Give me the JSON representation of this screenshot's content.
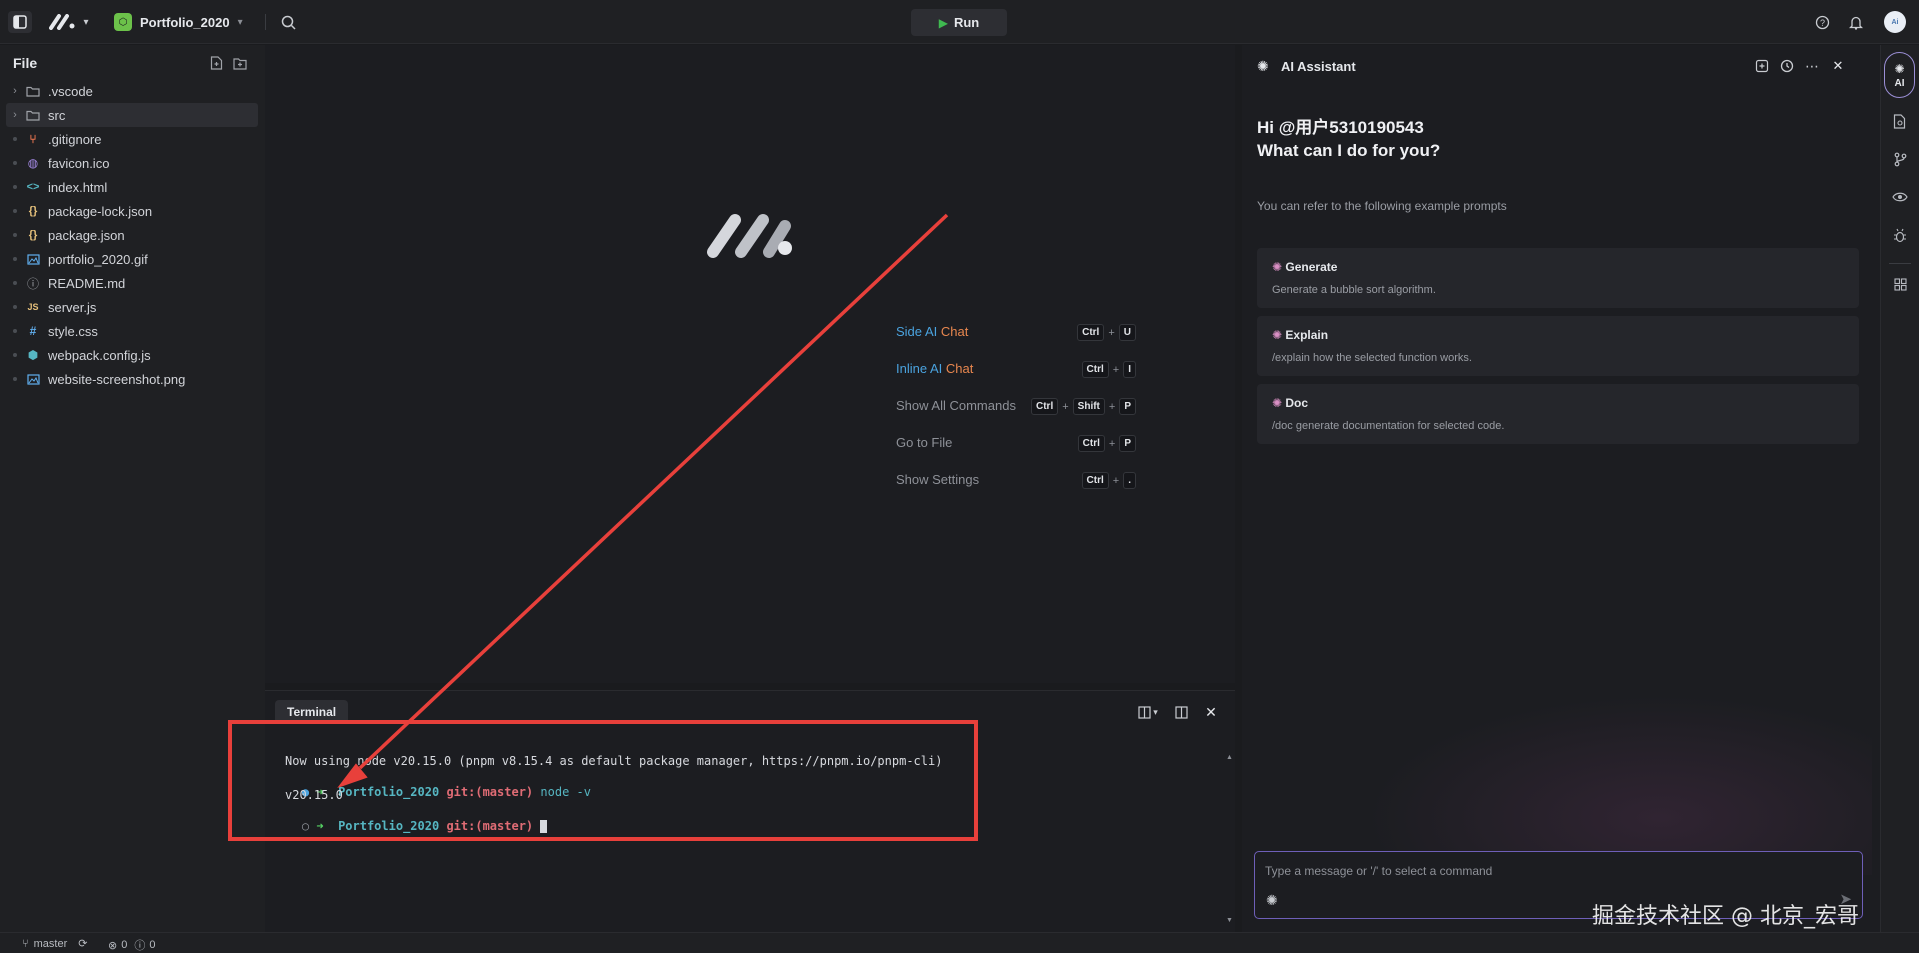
{
  "topbar": {
    "project_name": "Portfolio_2020",
    "run_label": "Run",
    "avatar_text": "Ai"
  },
  "sidebar": {
    "title": "File",
    "items": [
      {
        "label": ".vscode",
        "type": "folder",
        "icon": "folder-icon"
      },
      {
        "label": "src",
        "type": "folder",
        "icon": "folder-icon",
        "selected": true
      },
      {
        "label": ".gitignore",
        "type": "file",
        "icon": "git-icon",
        "color": "#e8744f"
      },
      {
        "label": "favicon.ico",
        "type": "file",
        "icon": "palette-icon",
        "color": "#a58ae6"
      },
      {
        "label": "index.html",
        "type": "file",
        "icon": "code-icon",
        "color": "#56b6c2"
      },
      {
        "label": "package-lock.json",
        "type": "file",
        "icon": "braces-icon",
        "color": "#e5c07b"
      },
      {
        "label": "package.json",
        "type": "file",
        "icon": "braces-icon",
        "color": "#e5c07b"
      },
      {
        "label": "portfolio_2020.gif",
        "type": "file",
        "icon": "image-icon",
        "color": "#61afef"
      },
      {
        "label": "README.md",
        "type": "file",
        "icon": "info-icon",
        "color": "#a0a3a9"
      },
      {
        "label": "server.js",
        "type": "file",
        "icon": "js-icon",
        "color": "#e5c07b"
      },
      {
        "label": "style.css",
        "type": "file",
        "icon": "hash-icon",
        "color": "#61afef"
      },
      {
        "label": "webpack.config.js",
        "type": "file",
        "icon": "cube-icon",
        "color": "#56b6c2"
      },
      {
        "label": "website-screenshot.png",
        "type": "file",
        "icon": "image-icon",
        "color": "#61afef"
      }
    ]
  },
  "editor": {
    "shortcuts": [
      {
        "label_a": "Side",
        "label_b": "AI",
        "label_c": "Chat",
        "keys": [
          "Ctrl",
          "U"
        ],
        "colored": true
      },
      {
        "label_a": "Inline",
        "label_b": "AI",
        "label_c": "Chat",
        "keys": [
          "Ctrl",
          "I"
        ],
        "colored": true
      },
      {
        "label_a": "Show All Commands",
        "keys": [
          "Ctrl",
          "Shift",
          "P"
        ],
        "colored": false
      },
      {
        "label_a": "Go to File",
        "keys": [
          "Ctrl",
          "P"
        ],
        "colored": false
      },
      {
        "label_a": "Show Settings",
        "keys": [
          "Ctrl",
          "."
        ],
        "colored": false
      }
    ]
  },
  "terminal": {
    "tab_label": "Terminal",
    "line1": "Now using node v20.15.0 (pnpm v8.15.4 as default package manager, https://pnpm.io/pnpm-cli)",
    "prompt_project": "Portfolio_2020",
    "prompt_git": "git:(master)",
    "command": "node -v",
    "output": "v20.15.0"
  },
  "ai": {
    "title": "AI Assistant",
    "greeting1": "Hi @用户5310190543",
    "greeting2": "What can I do for you?",
    "hint": "You can refer to the following example prompts",
    "prompts": [
      {
        "title": "Generate",
        "desc": "Generate a bubble sort algorithm."
      },
      {
        "title": "Explain",
        "desc": "/explain how the selected function works."
      },
      {
        "title": "Doc",
        "desc": "/doc generate documentation for selected code."
      }
    ],
    "input_placeholder": "Type a message or '/' to select a command"
  },
  "rightbar": {
    "ai_label": "AI"
  },
  "statusbar": {
    "branch": "master",
    "errors": "0",
    "warnings": "0"
  },
  "watermark": "掘金技术社区 @ 北京_宏哥",
  "colors": {
    "accent_blue": "#4aa3df",
    "accent_orange": "#e8874f",
    "run_green": "#3fb950",
    "annotation_red": "#e8403b",
    "prompt_cyan": "#56b6c2",
    "prompt_red": "#e06c75"
  }
}
